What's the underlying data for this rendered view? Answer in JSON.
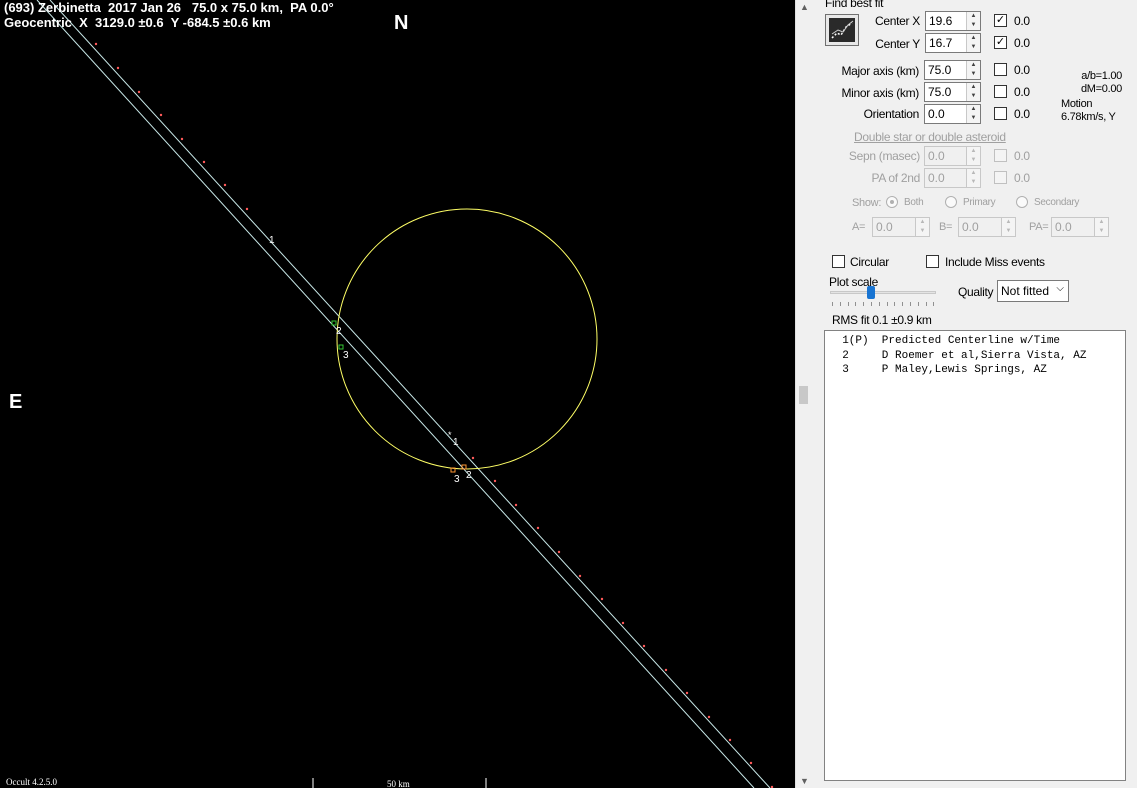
{
  "plot": {
    "title": "(693) Zerbinetta  2017 Jan 26   75.0 x 75.0 km,  PA 0.0°",
    "geocentric": "Geocentric  X  3129.0 ±0.6  Y -684.5 ±0.6 km",
    "north": "N",
    "east": "E",
    "version": "Occult 4.2.5.0",
    "scale_label": "50 km",
    "chord_labels": {
      "pre_1": "1",
      "pre_2": "2",
      "pre_3": "3",
      "post_1": "1",
      "post_2": "2",
      "post_3": "3"
    },
    "colors": {
      "background": "#000000",
      "outline": "#ffff66",
      "chord": "#c8e8e8",
      "timing_dot": "#ff5a5a",
      "station2": "#32c832",
      "station3": "#ff9632"
    }
  },
  "panel": {
    "group_title": "Find best fit",
    "center_x": {
      "label": "Center X",
      "value": "19.6",
      "checked": true,
      "uncertainty": "0.0"
    },
    "center_y": {
      "label": "Center Y",
      "value": "16.7",
      "checked": true,
      "uncertainty": "0.0"
    },
    "major_axis": {
      "label": "Major axis (km)",
      "value": "75.0",
      "checked": false,
      "uncertainty": "0.0"
    },
    "minor_axis": {
      "label": "Minor axis (km)",
      "value": "75.0",
      "checked": false,
      "uncertainty": "0.0"
    },
    "orientation": {
      "label": "Orientation",
      "value": "0.0",
      "checked": false,
      "uncertainty": "0.0"
    },
    "ab_ratio": "a/b=1.00",
    "dm": "dM=0.00",
    "motion_label": "Motion",
    "motion_value": "6.78km/s, Y",
    "double_star_link": "Double star  or  double asteroid",
    "sepn": {
      "label": "Sepn (masec)",
      "value": "0.0",
      "uncertainty": "0.0"
    },
    "pa2": {
      "label": "PA of 2nd",
      "value": "0.0",
      "uncertainty": "0.0"
    },
    "show_label": "Show:",
    "show_options": [
      "Both",
      "Primary",
      "Secondary"
    ],
    "show_selected": "Both",
    "a_label": "A=",
    "a_value": "0.0",
    "b_label": "B=",
    "b_value": "0.0",
    "pa_label": "PA=",
    "pa_value": "0.0",
    "circular_label": "Circular",
    "include_miss_label": "Include Miss events",
    "plot_scale_label": "Plot scale",
    "quality_label": "Quality",
    "quality_value": "Not fitted",
    "rms_fit": "RMS fit 0.1 ±0.9 km",
    "events": [
      "  1(P)  Predicted Centerline w/Time",
      "  2     D Roemer et al,Sierra Vista, AZ",
      "  3     P Maley,Lewis Springs, AZ"
    ]
  }
}
